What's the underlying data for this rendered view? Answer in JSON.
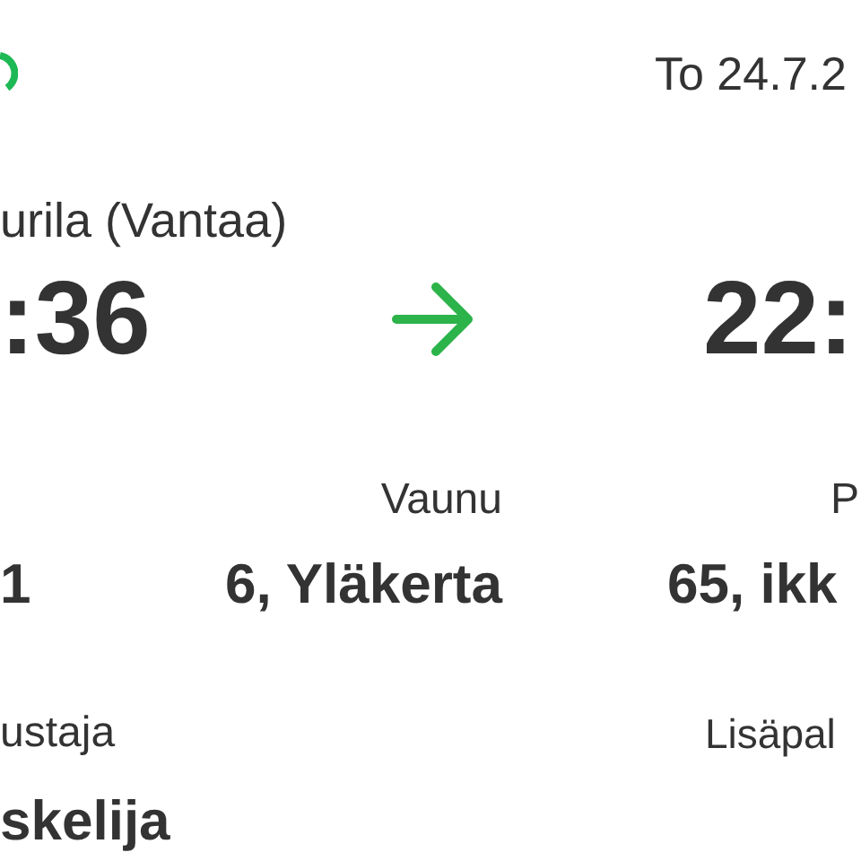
{
  "header": {
    "date": "To 24.7.2"
  },
  "departure": {
    "station": "urila (Vantaa)",
    "time": ":36"
  },
  "arrival": {
    "time": "22:"
  },
  "train": {
    "value": "1"
  },
  "car": {
    "label": "Vaunu",
    "value": "6, Yläkerta"
  },
  "seat": {
    "label": "P",
    "value": "65, ikk"
  },
  "passenger": {
    "label": "ustaja",
    "value": "skelija"
  },
  "extras": {
    "label": "Lisäpal"
  }
}
